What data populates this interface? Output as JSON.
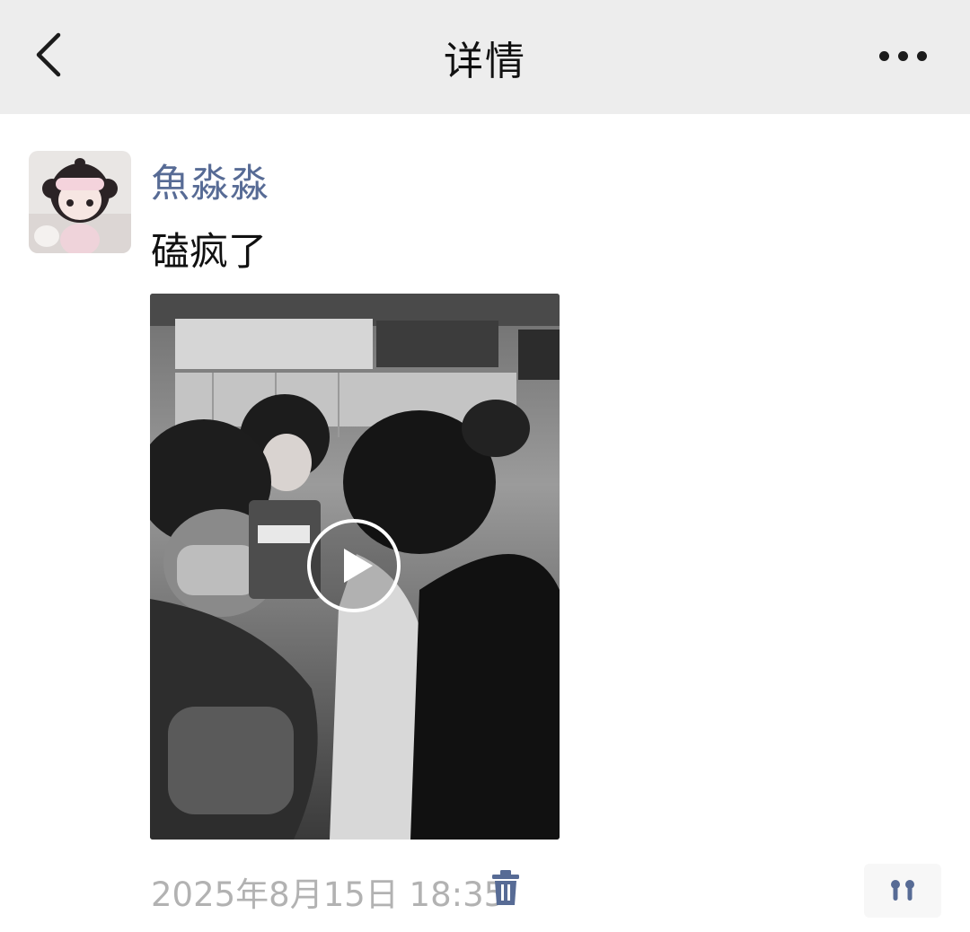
{
  "header": {
    "title": "详情",
    "back_icon": "chevron-left-icon",
    "more_icon": "more-horizontal-icon"
  },
  "post": {
    "username": "魚淼淼",
    "text": "磕疯了",
    "timestamp": "2025年8月15日 18:35",
    "media_type": "video",
    "delete_icon": "trash-icon",
    "action_icon": "comment-more-icon"
  },
  "colors": {
    "header_bg": "#ededed",
    "username": "#576b95",
    "timestamp": "#b2b2b2",
    "text": "#111111"
  }
}
